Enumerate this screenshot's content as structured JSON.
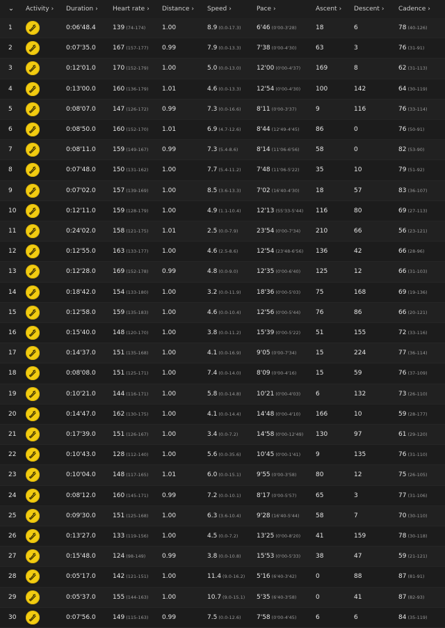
{
  "header": {
    "collapse_glyph": "⌄",
    "columns": [
      {
        "label": "Activity"
      },
      {
        "label": "Duration"
      },
      {
        "label": "Heart rate"
      },
      {
        "label": "Distance"
      },
      {
        "label": "Speed"
      },
      {
        "label": "Pace"
      },
      {
        "label": "Ascent"
      },
      {
        "label": "Descent"
      },
      {
        "label": "Cadence"
      }
    ],
    "sort_icon": "chevron-right-icon"
  },
  "activity_icon": {
    "name": "cycling-activity-icon",
    "color": "#f2cc11"
  },
  "rows": [
    {
      "n": "1",
      "duration": "0:06'48.4",
      "hr": "139",
      "hr_range": "(74-174)",
      "distance": "1.00",
      "speed": "8.9",
      "speed_range": "(0.0-17.3)",
      "pace": "6'46",
      "pace_range": "(0'00-3'28)",
      "ascent": "18",
      "descent": "6",
      "cadence": "78",
      "cadence_range": "(40-126)"
    },
    {
      "n": "2",
      "duration": "0:07'35.0",
      "hr": "167",
      "hr_range": "(157-177)",
      "distance": "0.99",
      "speed": "7.9",
      "speed_range": "(0.0-13.3)",
      "pace": "7'38",
      "pace_range": "(0'00-4'30)",
      "ascent": "63",
      "descent": "3",
      "cadence": "76",
      "cadence_range": "(31-91)"
    },
    {
      "n": "3",
      "duration": "0:12'01.0",
      "hr": "170",
      "hr_range": "(152-179)",
      "distance": "1.00",
      "speed": "5.0",
      "speed_range": "(0.0-13.0)",
      "pace": "12'00",
      "pace_range": "(0'00-4'37)",
      "ascent": "169",
      "descent": "8",
      "cadence": "62",
      "cadence_range": "(31-113)"
    },
    {
      "n": "4",
      "duration": "0:13'00.0",
      "hr": "160",
      "hr_range": "(136-179)",
      "distance": "1.01",
      "speed": "4.6",
      "speed_range": "(0.0-13.3)",
      "pace": "12'54",
      "pace_range": "(0'00-4'30)",
      "ascent": "100",
      "descent": "142",
      "cadence": "64",
      "cadence_range": "(30-119)"
    },
    {
      "n": "5",
      "duration": "0:08'07.0",
      "hr": "147",
      "hr_range": "(126-172)",
      "distance": "0.99",
      "speed": "7.3",
      "speed_range": "(0.0-16.6)",
      "pace": "8'11",
      "pace_range": "(0'00-3'37)",
      "ascent": "9",
      "descent": "116",
      "cadence": "76",
      "cadence_range": "(33-114)"
    },
    {
      "n": "6",
      "duration": "0:08'50.0",
      "hr": "160",
      "hr_range": "(152-170)",
      "distance": "1.01",
      "speed": "6.9",
      "speed_range": "(4.7-12.6)",
      "pace": "8'44",
      "pace_range": "(12'49-4'45)",
      "ascent": "86",
      "descent": "0",
      "cadence": "76",
      "cadence_range": "(50-91)"
    },
    {
      "n": "7",
      "duration": "0:08'11.0",
      "hr": "159",
      "hr_range": "(149-167)",
      "distance": "0.99",
      "speed": "7.3",
      "speed_range": "(5.4-8.6)",
      "pace": "8'14",
      "pace_range": "(11'06-6'56)",
      "ascent": "58",
      "descent": "0",
      "cadence": "82",
      "cadence_range": "(53-90)"
    },
    {
      "n": "8",
      "duration": "0:07'48.0",
      "hr": "150",
      "hr_range": "(131-162)",
      "distance": "1.00",
      "speed": "7.7",
      "speed_range": "(5.4-11.2)",
      "pace": "7'48",
      "pace_range": "(11'06-5'22)",
      "ascent": "35",
      "descent": "10",
      "cadence": "79",
      "cadence_range": "(51-92)"
    },
    {
      "n": "9",
      "duration": "0:07'02.0",
      "hr": "157",
      "hr_range": "(139-169)",
      "distance": "1.00",
      "speed": "8.5",
      "speed_range": "(3.6-13.3)",
      "pace": "7'02",
      "pace_range": "(16'40-4'30)",
      "ascent": "18",
      "descent": "57",
      "cadence": "83",
      "cadence_range": "(36-107)"
    },
    {
      "n": "10",
      "duration": "0:12'11.0",
      "hr": "159",
      "hr_range": "(128-179)",
      "distance": "1.00",
      "speed": "4.9",
      "speed_range": "(1.1-10.4)",
      "pace": "12'13",
      "pace_range": "(55'33-5'44)",
      "ascent": "116",
      "descent": "80",
      "cadence": "69",
      "cadence_range": "(27-113)"
    },
    {
      "n": "11",
      "duration": "0:24'02.0",
      "hr": "158",
      "hr_range": "(121-175)",
      "distance": "1.01",
      "speed": "2.5",
      "speed_range": "(0.0-7.9)",
      "pace": "23'54",
      "pace_range": "(0'00-7'34)",
      "ascent": "210",
      "descent": "66",
      "cadence": "56",
      "cadence_range": "(23-121)"
    },
    {
      "n": "12",
      "duration": "0:12'55.0",
      "hr": "163",
      "hr_range": "(133-177)",
      "distance": "1.00",
      "speed": "4.6",
      "speed_range": "(2.5-8.6)",
      "pace": "12'54",
      "pace_range": "(23'48-6'56)",
      "ascent": "136",
      "descent": "42",
      "cadence": "66",
      "cadence_range": "(28-96)"
    },
    {
      "n": "13",
      "duration": "0:12'28.0",
      "hr": "169",
      "hr_range": "(152-178)",
      "distance": "0.99",
      "speed": "4.8",
      "speed_range": "(0.0-9.0)",
      "pace": "12'35",
      "pace_range": "(0'00-6'40)",
      "ascent": "125",
      "descent": "12",
      "cadence": "66",
      "cadence_range": "(31-103)"
    },
    {
      "n": "14",
      "duration": "0:18'42.0",
      "hr": "154",
      "hr_range": "(133-180)",
      "distance": "1.00",
      "speed": "3.2",
      "speed_range": "(0.0-11.9)",
      "pace": "18'36",
      "pace_range": "(0'00-5'03)",
      "ascent": "75",
      "descent": "168",
      "cadence": "69",
      "cadence_range": "(19-136)"
    },
    {
      "n": "15",
      "duration": "0:12'58.0",
      "hr": "159",
      "hr_range": "(135-183)",
      "distance": "1.00",
      "speed": "4.6",
      "speed_range": "(0.0-10.4)",
      "pace": "12'56",
      "pace_range": "(0'00-5'44)",
      "ascent": "76",
      "descent": "86",
      "cadence": "66",
      "cadence_range": "(20-121)"
    },
    {
      "n": "16",
      "duration": "0:15'40.0",
      "hr": "148",
      "hr_range": "(120-170)",
      "distance": "1.00",
      "speed": "3.8",
      "speed_range": "(0.0-11.2)",
      "pace": "15'39",
      "pace_range": "(0'00-5'22)",
      "ascent": "51",
      "descent": "155",
      "cadence": "72",
      "cadence_range": "(33-116)"
    },
    {
      "n": "17",
      "duration": "0:14'37.0",
      "hr": "151",
      "hr_range": "(135-168)",
      "distance": "1.00",
      "speed": "4.1",
      "speed_range": "(0.0-16.9)",
      "pace": "9'05",
      "pace_range": "(0'00-7'34)",
      "ascent": "15",
      "descent": "224",
      "cadence": "77",
      "cadence_range": "(36-114)"
    },
    {
      "n": "18",
      "duration": "0:08'08.0",
      "hr": "151",
      "hr_range": "(125-171)",
      "distance": "1.00",
      "speed": "7.4",
      "speed_range": "(0.0-14.0)",
      "pace": "8'09",
      "pace_range": "(0'00-4'16)",
      "ascent": "15",
      "descent": "59",
      "cadence": "76",
      "cadence_range": "(37-109)"
    },
    {
      "n": "19",
      "duration": "0:10'21.0",
      "hr": "144",
      "hr_range": "(116-171)",
      "distance": "1.00",
      "speed": "5.8",
      "speed_range": "(0.0-14.8)",
      "pace": "10'21",
      "pace_range": "(0'00-4'03)",
      "ascent": "6",
      "descent": "132",
      "cadence": "73",
      "cadence_range": "(26-110)"
    },
    {
      "n": "20",
      "duration": "0:14'47.0",
      "hr": "162",
      "hr_range": "(130-175)",
      "distance": "1.00",
      "speed": "4.1",
      "speed_range": "(0.0-14.4)",
      "pace": "14'48",
      "pace_range": "(0'00-4'10)",
      "ascent": "166",
      "descent": "10",
      "cadence": "59",
      "cadence_range": "(28-177)"
    },
    {
      "n": "21",
      "duration": "0:17'39.0",
      "hr": "151",
      "hr_range": "(126-167)",
      "distance": "1.00",
      "speed": "3.4",
      "speed_range": "(0.0-7.2)",
      "pace": "14'58",
      "pace_range": "(0'00-12'49)",
      "ascent": "130",
      "descent": "97",
      "cadence": "61",
      "cadence_range": "(29-120)"
    },
    {
      "n": "22",
      "duration": "0:10'43.0",
      "hr": "128",
      "hr_range": "(112-140)",
      "distance": "1.00",
      "speed": "5.6",
      "speed_range": "(0.0-35.6)",
      "pace": "10'45",
      "pace_range": "(0'00-1'41)",
      "ascent": "9",
      "descent": "135",
      "cadence": "76",
      "cadence_range": "(31-110)"
    },
    {
      "n": "23",
      "duration": "0:10'04.0",
      "hr": "148",
      "hr_range": "(117-165)",
      "distance": "1.01",
      "speed": "6.0",
      "speed_range": "(0.0-15.1)",
      "pace": "9'55",
      "pace_range": "(0'00-3'58)",
      "ascent": "80",
      "descent": "12",
      "cadence": "75",
      "cadence_range": "(26-105)"
    },
    {
      "n": "24",
      "duration": "0:08'12.0",
      "hr": "160",
      "hr_range": "(145-171)",
      "distance": "0.99",
      "speed": "7.2",
      "speed_range": "(0.0-10.1)",
      "pace": "8'17",
      "pace_range": "(0'00-5'57)",
      "ascent": "65",
      "descent": "3",
      "cadence": "77",
      "cadence_range": "(31-106)"
    },
    {
      "n": "25",
      "duration": "0:09'30.0",
      "hr": "151",
      "hr_range": "(125-168)",
      "distance": "1.00",
      "speed": "6.3",
      "speed_range": "(3.6-10.4)",
      "pace": "9'28",
      "pace_range": "(16'40-5'44)",
      "ascent": "58",
      "descent": "7",
      "cadence": "70",
      "cadence_range": "(30-110)"
    },
    {
      "n": "26",
      "duration": "0:13'27.0",
      "hr": "133",
      "hr_range": "(119-156)",
      "distance": "1.00",
      "speed": "4.5",
      "speed_range": "(0.0-7.2)",
      "pace": "13'25",
      "pace_range": "(0'00-8'20)",
      "ascent": "41",
      "descent": "159",
      "cadence": "78",
      "cadence_range": "(30-118)"
    },
    {
      "n": "27",
      "duration": "0:15'48.0",
      "hr": "124",
      "hr_range": "(98-149)",
      "distance": "0.99",
      "speed": "3.8",
      "speed_range": "(0.0-10.8)",
      "pace": "15'53",
      "pace_range": "(0'00-5'33)",
      "ascent": "38",
      "descent": "47",
      "cadence": "59",
      "cadence_range": "(21-121)"
    },
    {
      "n": "28",
      "duration": "0:05'17.0",
      "hr": "142",
      "hr_range": "(121-151)",
      "distance": "1.00",
      "speed": "11.4",
      "speed_range": "(9.0-16.2)",
      "pace": "5'16",
      "pace_range": "(6'40-3'42)",
      "ascent": "0",
      "descent": "88",
      "cadence": "87",
      "cadence_range": "(81-91)"
    },
    {
      "n": "29",
      "duration": "0:05'37.0",
      "hr": "155",
      "hr_range": "(144-163)",
      "distance": "1.00",
      "speed": "10.7",
      "speed_range": "(9.0-15.1)",
      "pace": "5'35",
      "pace_range": "(6'40-3'58)",
      "ascent": "0",
      "descent": "41",
      "cadence": "87",
      "cadence_range": "(82-93)"
    },
    {
      "n": "30",
      "duration": "0:07'56.0",
      "hr": "149",
      "hr_range": "(115-163)",
      "distance": "0.99",
      "speed": "7.5",
      "speed_range": "(0.0-12.6)",
      "pace": "7'58",
      "pace_range": "(0'00-4'45)",
      "ascent": "6",
      "descent": "6",
      "cadence": "84",
      "cadence_range": "(35-119)"
    }
  ]
}
